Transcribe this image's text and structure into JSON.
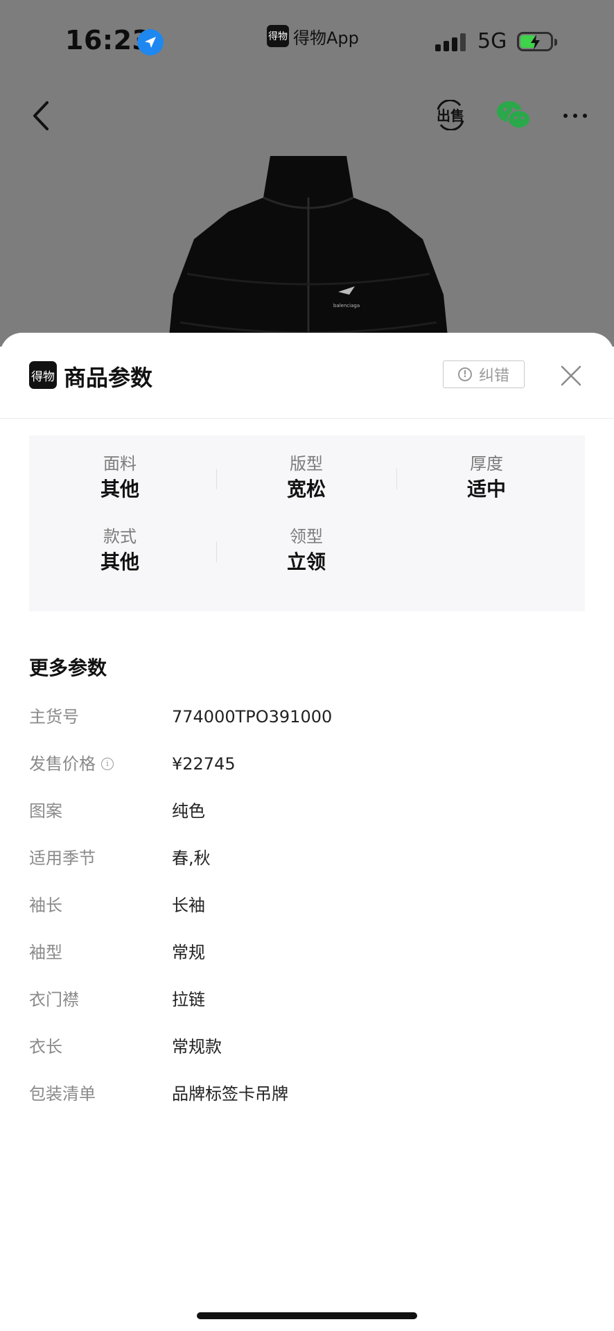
{
  "status_bar": {
    "time": "16:23",
    "app_indicator_logo": "得物",
    "app_indicator_name": "得物App",
    "network": "5G",
    "icons": [
      "location-arrow-icon",
      "signal-icon",
      "battery-charging-icon"
    ]
  },
  "nav": {
    "sell_label": "出售",
    "icons": [
      "back-icon",
      "sell-icon",
      "wechat-icon",
      "more-icon"
    ]
  },
  "product": {
    "logo_text": "balenciaga",
    "image_color": "#0b0b0b"
  },
  "sheet": {
    "logo_text": "得物",
    "title": "商品参数",
    "report_label": "纠错",
    "params": [
      {
        "label": "面料",
        "value": "其他"
      },
      {
        "label": "版型",
        "value": "宽松"
      },
      {
        "label": "厚度",
        "value": "适中"
      },
      {
        "label": "款式",
        "value": "其他"
      },
      {
        "label": "领型",
        "value": "立领"
      }
    ],
    "more_title": "更多参数",
    "specs": [
      {
        "label": "主货号",
        "value": "774000TPO391000"
      },
      {
        "label": "发售价格",
        "value": "¥22745"
      },
      {
        "label": "图案",
        "value": "纯色"
      },
      {
        "label": "适用季节",
        "value": "春,秋"
      },
      {
        "label": "袖长",
        "value": "长袖"
      },
      {
        "label": "袖型",
        "value": "常规"
      },
      {
        "label": "衣门襟",
        "value": "拉链"
      },
      {
        "label": "衣长",
        "value": "常规款"
      },
      {
        "label": "包装清单",
        "value": "品牌标签卡吊牌"
      }
    ]
  },
  "colors": {
    "backdrop": "#7d7d7d",
    "param_bg": "#f7f7f9",
    "location_blue": "#1e88f0",
    "battery_green": "#3fd24b",
    "wechat_green": "#2aa84a"
  }
}
